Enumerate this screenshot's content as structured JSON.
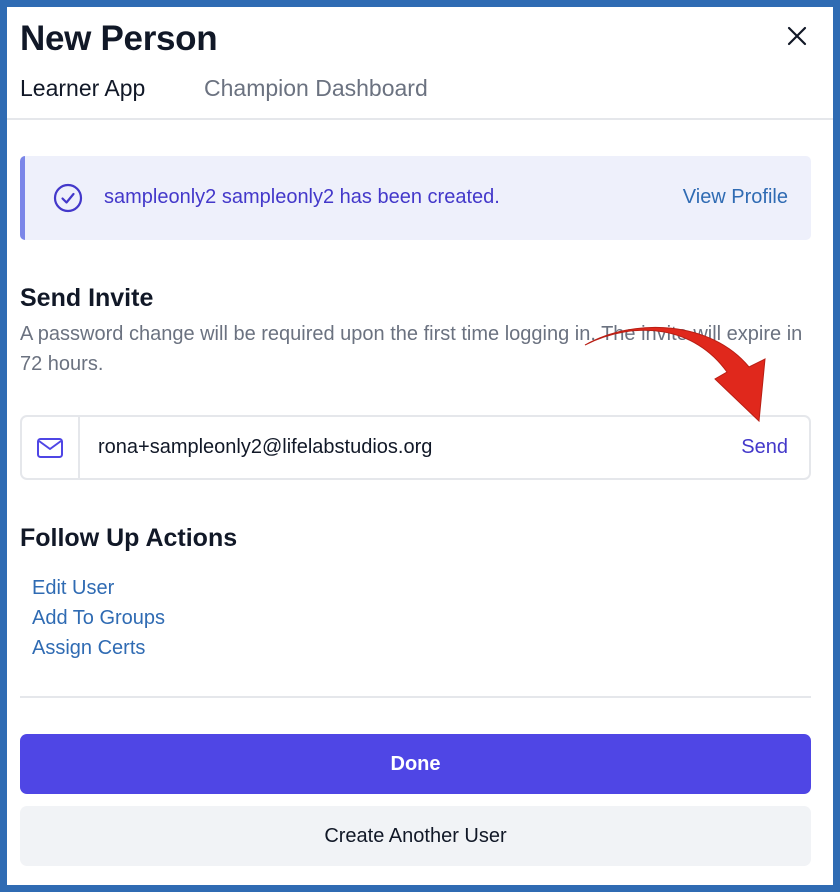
{
  "dialog": {
    "title": "New Person"
  },
  "tabs": [
    {
      "label": "Learner App",
      "active": true
    },
    {
      "label": "Champion Dashboard",
      "active": false
    }
  ],
  "alert": {
    "message": "sampleonly2 sampleonly2 has been created.",
    "link_label": "View Profile",
    "icon": "check-circle-icon"
  },
  "send_invite": {
    "heading": "Send Invite",
    "description": "A password change will be required upon the first time logging in. The invite will expire in 72 hours.",
    "email_value": "rona+sampleonly2@lifelabstudios.org",
    "email_icon": "mail-icon",
    "send_label": "Send"
  },
  "follow_up": {
    "heading": "Follow Up Actions",
    "links": [
      "Edit User",
      "Add To Groups",
      "Assign Certs"
    ]
  },
  "buttons": {
    "done_label": "Done",
    "create_another_label": "Create Another User"
  },
  "colors": {
    "primary": "#4f46e5",
    "link": "#2f6bb3",
    "alert_bg": "#eef0fb",
    "annotation_arrow": "#e0281c"
  }
}
